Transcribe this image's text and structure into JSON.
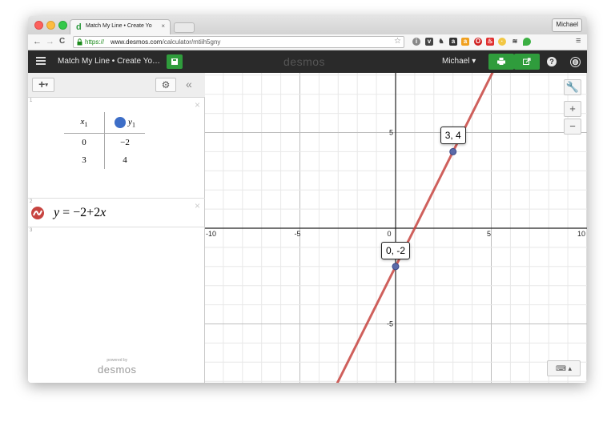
{
  "browser": {
    "tab_title": "Match My Line • Create Yo",
    "tab_close": "×",
    "profile": "Michael",
    "url_https": "https://",
    "url_host": "www.desmos.com",
    "url_path": "/calculator/mtiih5gny",
    "back_icon": "←",
    "forward_icon": "→",
    "reload_icon": "C",
    "star_icon": "☆",
    "menu_icon": "≡"
  },
  "header": {
    "doc_title": "Match My Line • Create Yo…",
    "logo": "desmos",
    "user": "Michael ▾"
  },
  "expressions": {
    "add_label": "+",
    "collapse_label": "«",
    "items": [
      {
        "num": "1",
        "type": "table",
        "headers": [
          "x",
          "1",
          "y",
          "1"
        ],
        "rows": [
          [
            "0",
            "−2"
          ],
          [
            "3",
            "4"
          ]
        ],
        "point_color": "#3d6ec7"
      },
      {
        "num": "2",
        "type": "expression",
        "latex_text": "y = −2 + 2x",
        "lhs": "y",
        "eq": "=",
        "minus2": "−2",
        "plus": "+",
        "coef": "2",
        "var": "x",
        "color": "#c74440"
      },
      {
        "num": "3",
        "type": "empty"
      }
    ],
    "powered_by": "powered by",
    "powered_logo": "desmos"
  },
  "graph": {
    "x_tick_labels": [
      "-10",
      "-5",
      "0",
      "5",
      "10"
    ],
    "y_tick_labels": [
      "5",
      "-5"
    ],
    "xlim": [
      -10,
      10
    ],
    "line": {
      "slope": 2,
      "intercept": -2,
      "color": "#c74440"
    },
    "points": [
      {
        "label": "3, 4",
        "x": 3,
        "y": 4
      },
      {
        "label": "0, -2",
        "x": 0,
        "y": -2
      }
    ],
    "wrench_icon": "wrench-icon",
    "zoom_in": "+",
    "zoom_out": "−",
    "keyboard_label": "⌨ ▴"
  }
}
